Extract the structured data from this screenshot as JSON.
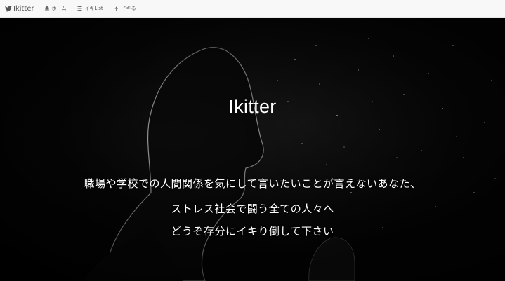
{
  "navbar": {
    "brand": "Ikitter",
    "items": [
      {
        "label": "ホーム",
        "icon": "home-icon"
      },
      {
        "label": "イキList",
        "icon": "list-icon"
      },
      {
        "label": "イキる",
        "icon": "bolt-icon"
      }
    ]
  },
  "hero": {
    "title": "Ikitter",
    "lines": [
      "職場や学校での人間関係を気にして言いたいことが言えないあなた、",
      "ストレス社会で闘う全ての人々へ",
      "どうぞ存分にイキり倒して下さい"
    ]
  },
  "colors": {
    "navbar_bg": "#f8f8f8",
    "navbar_text": "#555555",
    "hero_bg": "#000000",
    "hero_text": "#ffffff"
  }
}
